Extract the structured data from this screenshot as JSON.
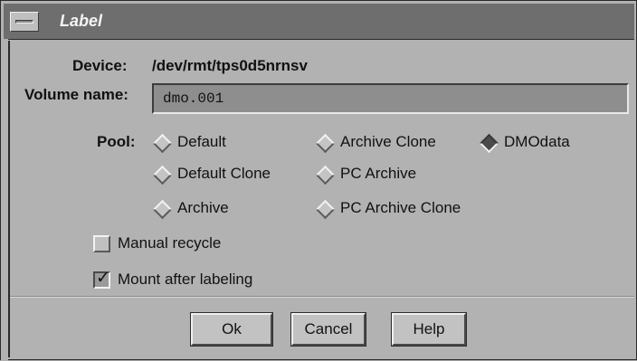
{
  "window": {
    "title": "Label"
  },
  "device": {
    "label": "Device:",
    "value": "/dev/rmt/tps0d5nrnsv"
  },
  "volume": {
    "label": "Volume name:",
    "value": "dmo.001"
  },
  "pool": {
    "label": "Pool:",
    "options": [
      "Default",
      "Archive Clone",
      "DMOdata",
      "Default Clone",
      "PC Archive",
      "Archive",
      "PC Archive Clone"
    ],
    "selected": "DMOdata"
  },
  "options": {
    "manual_recycle": {
      "label": "Manual recycle",
      "checked": false
    },
    "mount_after_labeling": {
      "label": "Mount after labeling",
      "checked": true
    }
  },
  "buttons": {
    "ok": "Ok",
    "cancel": "Cancel",
    "help": "Help"
  }
}
